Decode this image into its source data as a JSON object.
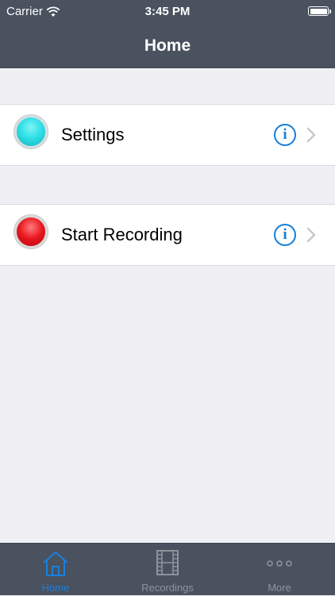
{
  "status_bar": {
    "carrier": "Carrier",
    "time": "3:45 PM",
    "wifi_icon": "wifi-icon",
    "battery_icon": "battery-icon"
  },
  "nav": {
    "title": "Home"
  },
  "rows": [
    {
      "label": "Settings",
      "dot_color": "#2fe0e6",
      "dot_icon": "cyan-dot-icon",
      "info_icon": "info-icon",
      "info_glyph": "i",
      "chevron_icon": "chevron-right-icon"
    },
    {
      "label": "Start Recording",
      "dot_color": "#e8151c",
      "dot_icon": "record-dot-icon",
      "info_icon": "info-icon",
      "info_glyph": "i",
      "chevron_icon": "chevron-right-icon"
    }
  ],
  "tab_bar": {
    "tabs": [
      {
        "label": "Home",
        "icon": "home-icon",
        "selected": true
      },
      {
        "label": "Recordings",
        "icon": "film-icon",
        "selected": false
      },
      {
        "label": "More",
        "icon": "more-dots-icon",
        "selected": false
      }
    ]
  },
  "colors": {
    "bar_background": "#49525e",
    "accent": "#147fd8",
    "tab_selected": "#1a7fe0",
    "tab_unselected": "#8e949c",
    "page_background": "#efeff4"
  }
}
